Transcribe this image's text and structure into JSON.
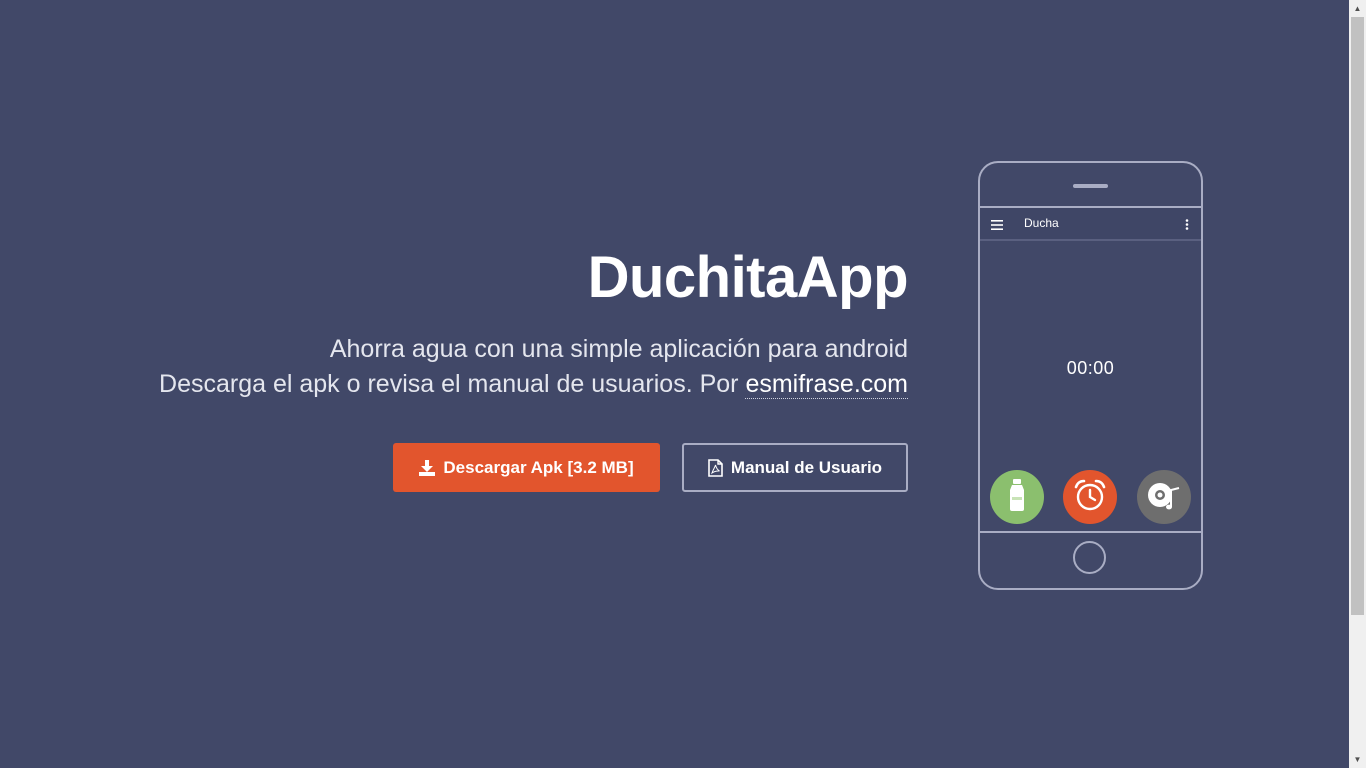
{
  "hero": {
    "title": "DuchitaApp",
    "subtitle_line1": "Ahorra agua con una simple aplicación para android",
    "subtitle_line2_prefix": "Descarga el apk o revisa el manual de usuarios. Por ",
    "site_link": "esmifrase.com"
  },
  "buttons": {
    "download_label": "Descargar Apk [3.2 MB]",
    "download_icon": "download-icon",
    "manual_label": "Manual de Usuario",
    "manual_icon": "pdf-file-icon"
  },
  "phone": {
    "app_title": "Ducha",
    "timer": "00:00",
    "actions": [
      "bottle-icon",
      "alarm-clock-icon",
      "music-disc-icon"
    ]
  },
  "colors": {
    "background": "#414868",
    "accent": "#e2552d",
    "bottle_green": "#8bbf6e",
    "music_gray": "#6e6e6e",
    "outline": "#a9adc4"
  }
}
